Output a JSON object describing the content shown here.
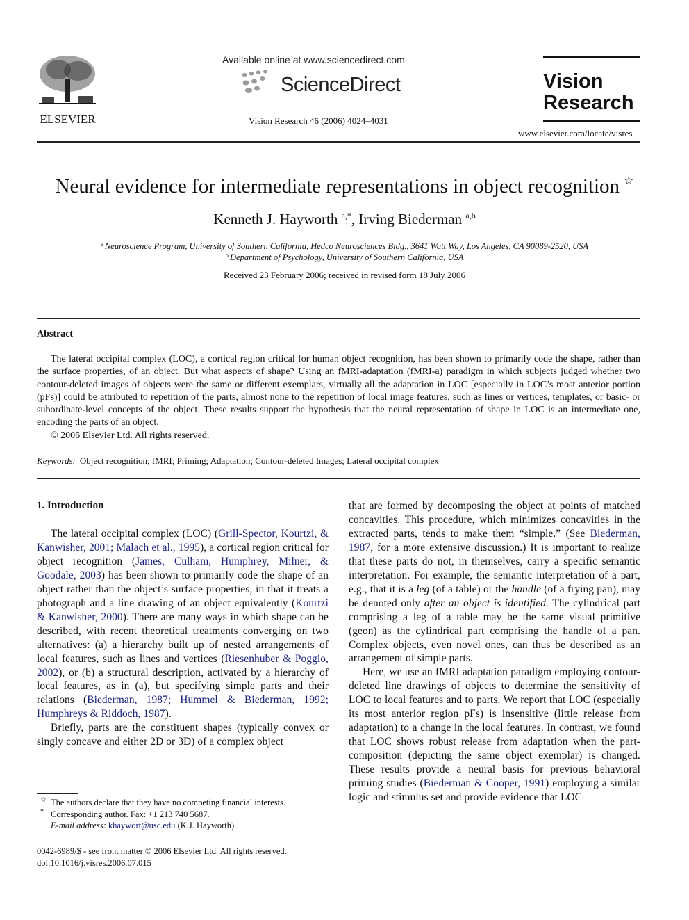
{
  "header": {
    "publisher_logo_text": "ELSEVIER",
    "available_online": "Available online at www.sciencedirect.com",
    "sciencedirect_logo_text": "ScienceDirect",
    "journal_citation": "Vision Research 46 (2006) 4024–4031",
    "journal_title_line1": "Vision",
    "journal_title_line2": "Research",
    "journal_url": "www.elsevier.com/locate/visres"
  },
  "article": {
    "title": "Neural evidence for intermediate representations in object recognition",
    "title_note_mark": "☆",
    "authors": [
      {
        "name": "Kenneth J. Hayworth",
        "sup": "a,*"
      },
      {
        "name": "Irving Biederman",
        "sup": "a,b"
      }
    ],
    "author_separator": ", ",
    "affiliations": [
      {
        "mark": "a",
        "text": "Neuroscience Program, University of Southern California, Hedco Neurosciences Bldg., 3641 Watt Way, Los Angeles, CA 90089-2520, USA"
      },
      {
        "mark": "b",
        "text": "Department of Psychology, University of Southern California, USA"
      }
    ],
    "received": "Received 23 February 2006; received in revised form 18 July 2006"
  },
  "abstract": {
    "heading": "Abstract",
    "body": "The lateral occipital complex (LOC), a cortical region critical for human object recognition, has been shown to primarily code the shape, rather than the surface properties, of an object. But what aspects of shape? Using an fMRI-adaptation (fMRI-a) paradigm in which subjects judged whether two contour-deleted images of objects were the same or different exemplars, virtually all the adaptation in LOC [especially in LOC’s most anterior portion (pFs)] could be attributed to repetition of the parts, almost none to the repetition of local image features, such as lines or vertices, templates, or basic- or subordinate-level concepts of the object. These results support the hypothesis that the neural representation of shape in LOC is an intermediate one, encoding the parts of an object.",
    "copyright": "© 2006 Elsevier Ltd. All rights reserved.",
    "keywords_label": "Keywords:",
    "keywords": "Object recognition; fMRI; Priming; Adaptation; Contour-deleted Images; Lateral occipital complex"
  },
  "introduction": {
    "heading": "1. Introduction",
    "p1": [
      {
        "t": "The lateral occipital complex (LOC) ("
      },
      {
        "t": "Grill-Spector, Kourtzi, & Kanwisher, 2001; Malach et al., 1995",
        "ref": true
      },
      {
        "t": "), a cortical region critical for object recognition ("
      },
      {
        "t": "James, Culham, Humphrey, Milner, & Goodale, 2003",
        "ref": true
      },
      {
        "t": ") has been shown to primarily code the shape of an object rather than the object’s surface properties, in that it treats a photograph and a line drawing of an object equivalently ("
      },
      {
        "t": "Kourtzi & Kanwisher, 2000",
        "ref": true
      },
      {
        "t": "). There are many ways in which shape can be described, with recent theoretical treatments converging on two alternatives: (a) a hierarchy built up of nested arrangements of local features, such as lines and vertices ("
      },
      {
        "t": "Riesenhuber & Poggio, 2002",
        "ref": true
      },
      {
        "t": "), or (b) a structural description, activated by a hierarchy of local features, as in (a), but specifying simple parts and their relations ("
      },
      {
        "t": "Biederman, 1987; Hummel & Biederman, 1992; Humphreys & Riddoch, 1987",
        "ref": true
      },
      {
        "t": ")."
      }
    ],
    "p2_left": "Briefly, parts are the constituent shapes (typically convex or singly concave and either 2D or 3D) of a complex object",
    "p2_right": [
      {
        "t": "that are formed by decomposing the object at points of matched concavities. This procedure, which minimizes concavities in the extracted parts, tends to make them “simple.” (See "
      },
      {
        "t": "Biederman, 1987",
        "ref": true
      },
      {
        "t": ", for a more extensive discussion.) It is important to realize that these parts do not, in themselves, carry a specific semantic interpretation. For example, the semantic interpretation of a part, e.g., that it is a "
      },
      {
        "t": "leg",
        "em": true
      },
      {
        "t": " (of a table) or the "
      },
      {
        "t": "handle",
        "em": true
      },
      {
        "t": " (of a frying pan), may be denoted only "
      },
      {
        "t": "after an object is identified.",
        "em": true
      },
      {
        "t": " The cylindrical part comprising a leg of a table may be the same visual primitive (geon) as the cylindrical part comprising the handle of a pan. Complex objects, even novel ones, can thus be described as an arrangement of simple parts."
      }
    ],
    "p3": [
      {
        "t": "Here, we use an fMRI adaptation paradigm employing contour-deleted line drawings of objects to determine the sensitivity of LOC to local features and to parts. We report that LOC (especially its most anterior region pFs) is insensitive (little release from adaptation) to a change in the local features. In contrast, we found that LOC shows robust release from adaptation when the part-composition (depicting the same object exemplar) is changed. These results provide a neural basis for previous behavioral priming studies ("
      },
      {
        "t": "Biederman & Cooper, 1991",
        "ref": true
      },
      {
        "t": ") employing a similar logic and stimulus set and provide evidence that LOC"
      }
    ]
  },
  "footnotes": {
    "star_mark": "☆",
    "star_text": "The authors declare that they have no competing financial interests.",
    "corr_mark": "*",
    "corr_text": "Corresponding author. Fax: +1 213 740 5687.",
    "email_label": "E-mail address:",
    "email": "khaywort@usc.edu",
    "email_suffix": " (K.J. Hayworth).",
    "front_matter": "0042-6989/$ - see front matter © 2006 Elsevier Ltd. All rights reserved.",
    "doi": "doi:10.1016/j.visres.2006.07.015"
  },
  "colors": {
    "link": "#1a237e",
    "text": "#111111"
  }
}
